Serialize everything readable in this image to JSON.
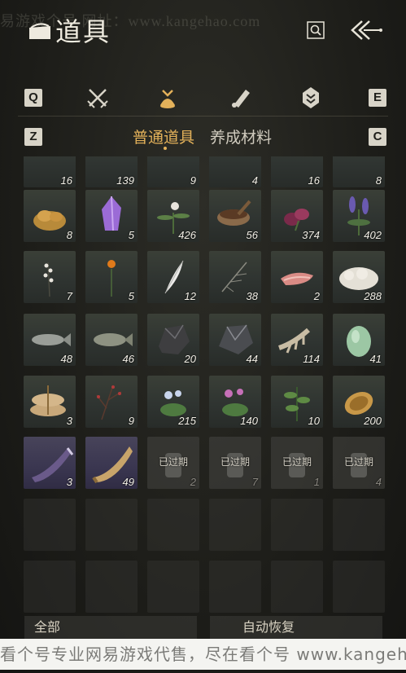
{
  "watermark_top": "易游戏个号  网址：www.kangehao.com",
  "header": {
    "title": "道具"
  },
  "keys": {
    "q": "Q",
    "e": "E",
    "z": "Z",
    "c": "C"
  },
  "subtabs": [
    {
      "label": "普通道具",
      "active": true
    },
    {
      "label": "养成材料",
      "active": false
    }
  ],
  "expired_label": "已过期",
  "rows": [
    [
      {
        "name": "item-partial",
        "count": "16"
      },
      {
        "name": "item-partial",
        "count": "139"
      },
      {
        "name": "item-partial",
        "count": "9"
      },
      {
        "name": "item-partial",
        "count": "4"
      },
      {
        "name": "item-partial",
        "count": "16"
      },
      {
        "name": "item-partial",
        "count": "8"
      }
    ],
    [
      {
        "name": "gold-ore",
        "count": "8"
      },
      {
        "name": "amethyst-crystal",
        "count": "5"
      },
      {
        "name": "white-flower-herb",
        "count": "426"
      },
      {
        "name": "medicine-bowl",
        "count": "56"
      },
      {
        "name": "purple-flower",
        "count": "374"
      },
      {
        "name": "lavender",
        "count": "402"
      }
    ],
    [
      {
        "name": "white-blossom-sprig",
        "count": "7"
      },
      {
        "name": "orange-flower",
        "count": "5"
      },
      {
        "name": "white-feather",
        "count": "12"
      },
      {
        "name": "dry-twig",
        "count": "38"
      },
      {
        "name": "raw-meat",
        "count": "2"
      },
      {
        "name": "wool-fleece",
        "count": "288"
      }
    ],
    [
      {
        "name": "grey-fish",
        "count": "48"
      },
      {
        "name": "carp-fish",
        "count": "46"
      },
      {
        "name": "dark-ore",
        "count": "20"
      },
      {
        "name": "iron-ore",
        "count": "44"
      },
      {
        "name": "bone-fragment",
        "count": "114"
      },
      {
        "name": "green-gourd",
        "count": "41"
      }
    ],
    [
      {
        "name": "grain-sacks",
        "count": "3"
      },
      {
        "name": "red-berry-branch",
        "count": "9"
      },
      {
        "name": "blue-flower-herb",
        "count": "215"
      },
      {
        "name": "pink-flower-herb",
        "count": "140"
      },
      {
        "name": "green-herb",
        "count": "10"
      },
      {
        "name": "gold-scroll",
        "count": "200"
      }
    ],
    [
      {
        "name": "war-horn",
        "count": "3",
        "purple": true
      },
      {
        "name": "ivory-horn",
        "count": "49",
        "purple": true
      },
      {
        "name": "expired-item",
        "count": "2",
        "expired": true
      },
      {
        "name": "expired-item",
        "count": "7",
        "expired": true
      },
      {
        "name": "expired-item",
        "count": "1",
        "expired": true
      },
      {
        "name": "expired-item",
        "count": "4",
        "expired": true
      }
    ]
  ],
  "footer": {
    "left_label": "全部",
    "right_label": "自动恢复"
  },
  "banner": "看个号专业网易游戏代售，尽在看个号 www.kangehao.com"
}
